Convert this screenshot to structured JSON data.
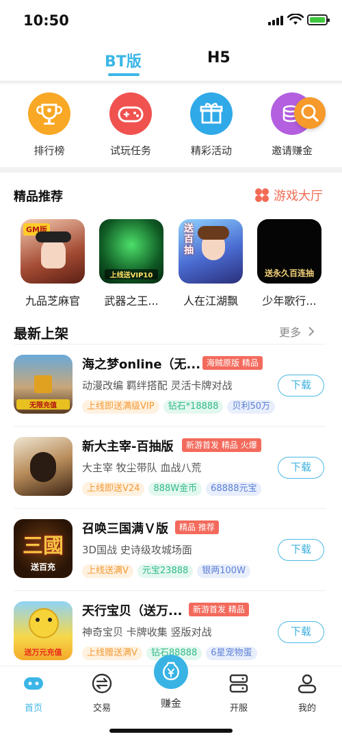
{
  "status": {
    "time": "10:50"
  },
  "top_tabs": {
    "active": "BT版",
    "inactive": "H5"
  },
  "quick_actions": [
    {
      "label": "排行榜",
      "icon": "trophy-icon",
      "color": "#f9a825"
    },
    {
      "label": "试玩任务",
      "icon": "gamepad-icon",
      "color": "#f0524f"
    },
    {
      "label": "精彩活动",
      "icon": "gift-icon",
      "color": "#2fa9e8"
    },
    {
      "label": "邀请赚金",
      "icon": "coins-icon",
      "color": "#b45fe0"
    }
  ],
  "featured": {
    "title": "精品推荐",
    "lobby_label": "游戏大厅",
    "items": [
      {
        "name": "九品芝麻官",
        "cover_text": "GM版"
      },
      {
        "name": "武器之王...",
        "cover_text": "上线送VIP10"
      },
      {
        "name": "人在江湖飘",
        "cover_text": "送百抽"
      },
      {
        "name": "少年歌行...",
        "cover_text": "送永久百连抽"
      }
    ]
  },
  "new_arrivals": {
    "title": "最新上架",
    "more_label": "更多",
    "games": [
      {
        "name": "海之梦online（无...",
        "badge": "海贼原版 精品",
        "desc": "动漫改编 羁绊搭配 灵活卡牌对战",
        "tags": [
          "上线即送满级VIP",
          "钻石*18888",
          "贝利50万"
        ],
        "cover_text": "无限充值",
        "download": "下载"
      },
      {
        "name": "新大主宰-百抽版",
        "badge": "新游首发 精品 火爆",
        "desc": "大主宰 牧尘带队 血战八荒",
        "tags": [
          "上线即送V24",
          "888W金币",
          "68888元宝"
        ],
        "cover_text": "",
        "download": "下载"
      },
      {
        "name": "召唤三国满Ｖ版",
        "badge": "精品 推荐",
        "desc": "3D国战 史诗级攻城场面",
        "tags": [
          "上线送满V",
          "元宝23888",
          "银两100W"
        ],
        "cover_text": "三國",
        "cover_sub": "送百充",
        "download": "下载"
      },
      {
        "name": "天行宝贝（送万...",
        "badge": "新游首发 精品",
        "desc": "神奇宝贝 卡牌收集 竖版对战",
        "tags": [
          "上线赠送满V",
          "钻石88888",
          "6星宠物蛋"
        ],
        "cover_text": "送万元充值",
        "download": "下载"
      }
    ]
  },
  "bottom_nav": {
    "home": "首页",
    "trade": "交易",
    "earn": "赚金",
    "server": "开服",
    "mine": "我的"
  }
}
